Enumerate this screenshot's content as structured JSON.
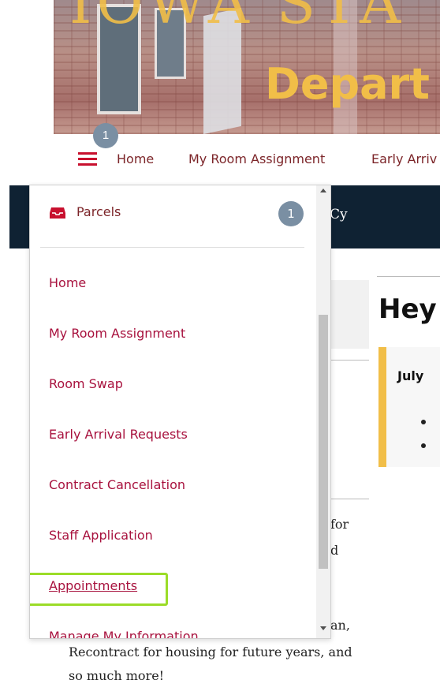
{
  "header": {
    "banner_text_top": "IOWA STA",
    "banner_text_dept": "Depart"
  },
  "topnav": {
    "notification_count": "1",
    "links": [
      "Home",
      "My Room Assignment",
      "Early Arriv"
    ]
  },
  "darkband": {
    "text": "Cy"
  },
  "background": {
    "heading": "Hey",
    "alert_title": "July",
    "fragments": [
      "for",
      "d",
      "an,",
      "Recontract for housing for future years, and",
      "so much more!"
    ]
  },
  "menu": {
    "parcels_label": "Parcels",
    "parcels_count": "1",
    "items": [
      "Home",
      "My Room Assignment",
      "Room Swap",
      "Early Arrival Requests",
      "Contract Cancellation",
      "Staff Application",
      "Appointments",
      "Manage My Information"
    ]
  },
  "colors": {
    "brand_red": "#c8102e",
    "link_red": "#a8123e",
    "gold": "#f1be48",
    "dark_navy": "#0f2233",
    "badge_gray": "#7a8fa3",
    "highlight_green": "#9bdc28"
  },
  "icons": [
    "hamburger-icon",
    "inbox-icon",
    "scroll-up-icon",
    "scroll-down-icon"
  ]
}
